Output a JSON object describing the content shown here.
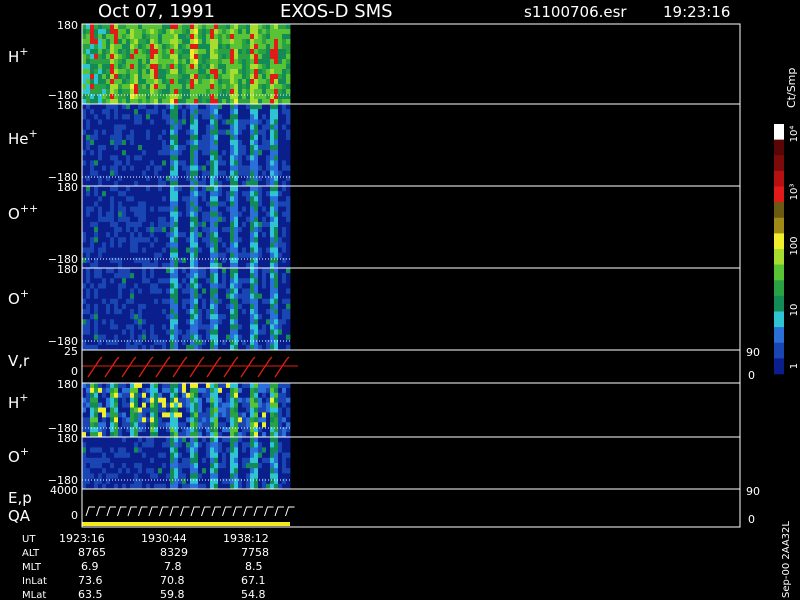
{
  "header": {
    "date": "Oct 07, 1991",
    "instrument": "EXOS-D SMS",
    "file": "s1100706.esr",
    "time": "19:23:16"
  },
  "colorbar": {
    "unit_label": "Ct/Smp",
    "tick_labels": [
      "1",
      "10",
      "100",
      "10³",
      "10⁴"
    ],
    "colors": [
      "#0b1f8c",
      "#1a46b4",
      "#2b6fd8",
      "#2fc4d4",
      "#148a57",
      "#2aa142",
      "#57c335",
      "#a6dd2f",
      "#f1ef2b",
      "#9f8a18",
      "#6c5a12",
      "#e11b18",
      "#b71010",
      "#7b0b0b",
      "#5a0606",
      "#ffffff"
    ]
  },
  "panels": [
    {
      "id": "h-plus",
      "label": "H",
      "superscript": "+",
      "ymax": "180",
      "ymin": "−180"
    },
    {
      "id": "he-plus",
      "label": "He",
      "superscript": "+",
      "ymax": "180",
      "ymin": "−180"
    },
    {
      "id": "o-plusplus",
      "label": "O",
      "superscript": "++",
      "ymax": "180",
      "ymin": "−180"
    },
    {
      "id": "o-plus",
      "label": "O",
      "superscript": "+",
      "ymax": "180",
      "ymin": "−180"
    },
    {
      "id": "vr",
      "label": "V,r",
      "superscript": "",
      "ymax": "25",
      "ymin": "0",
      "right_max": "90",
      "right_min": "0"
    },
    {
      "id": "h-plus-2",
      "label": "H",
      "superscript": "+",
      "ymax": "180",
      "ymin": "−180"
    },
    {
      "id": "o-plus-2",
      "label": "O",
      "superscript": "+",
      "ymax": "180",
      "ymin": "−180"
    },
    {
      "id": "ep-qa",
      "label": "E,p",
      "label2": "QA",
      "superscript": "",
      "ymax": "4000",
      "ymin": "0",
      "right_max": "90",
      "right_min": "0"
    }
  ],
  "footer": {
    "row_labels": [
      "UT",
      "ALT",
      "MLT",
      "InLat",
      "MLat"
    ],
    "columns": [
      [
        "1923:16",
        "8765",
        "6.9",
        "73.6",
        "63.5"
      ],
      [
        "1930:44",
        "8329",
        "7.8",
        "70.8",
        "59.8"
      ],
      [
        "1938:12",
        "7758",
        "8.5",
        "67.1",
        "54.8"
      ]
    ],
    "side_label": "Sep-00  2AA32L"
  },
  "chart_data": {
    "type": "heatmap",
    "title": "Oct 07, 1991   EXOS-D SMS",
    "panel_names": [
      "H+",
      "He+",
      "O++",
      "O+",
      "V,r",
      "H+",
      "O+",
      "E,p / QA"
    ],
    "x_tick_labels": [
      "1923:16",
      "1930:44",
      "1938:12"
    ],
    "pitch_angle_range": [
      -180,
      180
    ],
    "velocity_range": [
      0,
      25
    ],
    "energy_range": [
      0,
      4000
    ],
    "color_scale": "log",
    "color_range_counts": [
      1,
      10000
    ],
    "colorbar_label": "Ct/Smp"
  }
}
